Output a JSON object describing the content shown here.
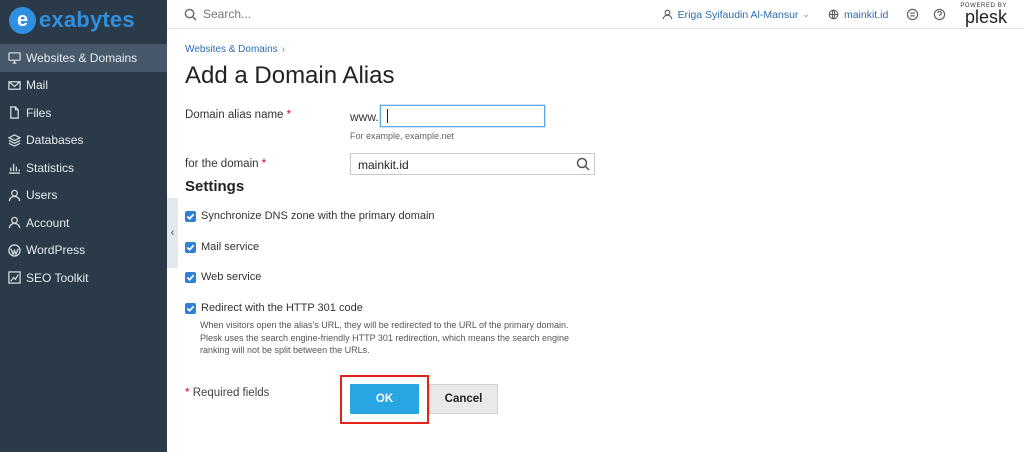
{
  "brand": {
    "logo_letter": "e",
    "logo_text": "exabytes"
  },
  "sidebar": {
    "items": [
      {
        "label": "Websites & Domains",
        "icon": "monitor-icon",
        "active": true
      },
      {
        "label": "Mail",
        "icon": "mail-icon"
      },
      {
        "label": "Files",
        "icon": "file-icon"
      },
      {
        "label": "Databases",
        "icon": "database-icon"
      },
      {
        "label": "Statistics",
        "icon": "bar-chart-icon"
      },
      {
        "label": "Users",
        "icon": "user-icon"
      },
      {
        "label": "Account",
        "icon": "account-icon"
      },
      {
        "label": "WordPress",
        "icon": "wordpress-icon"
      },
      {
        "label": "SEO Toolkit",
        "icon": "seo-icon"
      }
    ],
    "collapse_glyph": "‹"
  },
  "topbar": {
    "search_placeholder": "Search...",
    "user_name": "Eriga Syifaudin Al-Mansur",
    "subscription": "mainkit.id",
    "plesk_small": "POWERED BY",
    "plesk_big": "plesk"
  },
  "page": {
    "breadcrumb": "Websites & Domains",
    "breadcrumb_sep": "›",
    "title": "Add a Domain Alias"
  },
  "form": {
    "alias_label": "Domain alias name",
    "required_mark": "*",
    "alias_prefix": "www.",
    "alias_value": "",
    "alias_hint": "For example, example.net",
    "domain_label": "for the domain",
    "domain_value": "mainkit.id",
    "settings_heading": "Settings",
    "checkboxes": [
      {
        "label": "Synchronize DNS zone with the primary domain",
        "checked": true
      },
      {
        "label": "Mail service",
        "checked": true
      },
      {
        "label": "Web service",
        "checked": true
      },
      {
        "label": "Redirect with the HTTP 301 code",
        "checked": true
      }
    ],
    "redirect_description": "When visitors open the alias's URL, they will be redirected to the URL of the primary domain. Plesk uses the search engine-friendly HTTP 301 redirection, which means the search engine ranking will not be split between the URLs.",
    "required_note": "Required fields",
    "ok_label": "OK",
    "cancel_label": "Cancel"
  },
  "colors": {
    "sidebar_bg": "#2b3a48",
    "accent": "#28a5e3",
    "highlight_frame": "#e0241a",
    "link": "#2a6db0"
  }
}
